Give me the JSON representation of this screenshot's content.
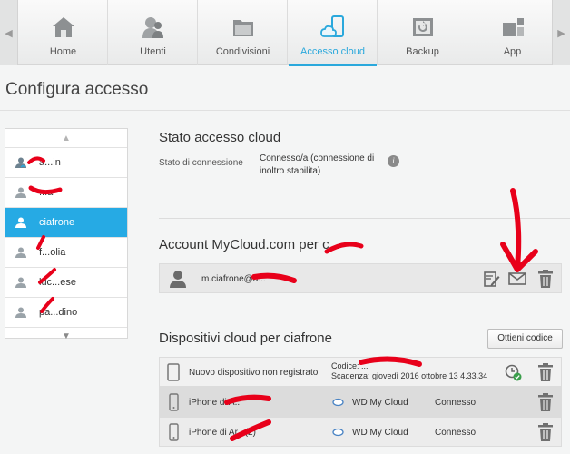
{
  "nav": {
    "items": [
      {
        "label": "Home",
        "icon": "home-icon"
      },
      {
        "label": "Utenti",
        "icon": "users-icon"
      },
      {
        "label": "Condivisioni",
        "icon": "folder-icon"
      },
      {
        "label": "Accesso cloud",
        "icon": "cloud-devices-icon",
        "active": true
      },
      {
        "label": "Backup",
        "icon": "backup-icon"
      },
      {
        "label": "App",
        "icon": "apps-icon"
      }
    ]
  },
  "page": {
    "title": "Configura accesso"
  },
  "users": {
    "items": [
      {
        "label": "a...in"
      },
      {
        "label": "...a"
      },
      {
        "label": "ciafrone",
        "selected": true
      },
      {
        "label": "f...olia"
      },
      {
        "label": "luc...ese"
      },
      {
        "label": "pa...dino"
      }
    ]
  },
  "cloud_status": {
    "title": "Stato accesso cloud",
    "label": "Stato di connessione",
    "value_line1": "Connesso/a (connessione di",
    "value_line2": "inoltro stabilita)"
  },
  "account": {
    "title": "Account MyCloud.com per c...",
    "email": "m.ciafrone@a..."
  },
  "devices": {
    "title": "Dispositivi cloud per ciafrone",
    "get_code_label": "Ottieni codice",
    "new_device": {
      "name": "Nuovo dispositivo non registrato",
      "code_line": "Codice: ...",
      "expiry_line": "Scadenza: giovedì 2016 ottobre 13 4.33.34"
    },
    "rows": [
      {
        "name": "iPhone di A...",
        "app": "WD My Cloud",
        "status": "Connesso"
      },
      {
        "name": "iPhone di Ar...(2)",
        "app": "WD My Cloud",
        "status": "Connesso"
      }
    ]
  },
  "colors": {
    "accent": "#26aae4",
    "annotation": "#e8001a"
  }
}
